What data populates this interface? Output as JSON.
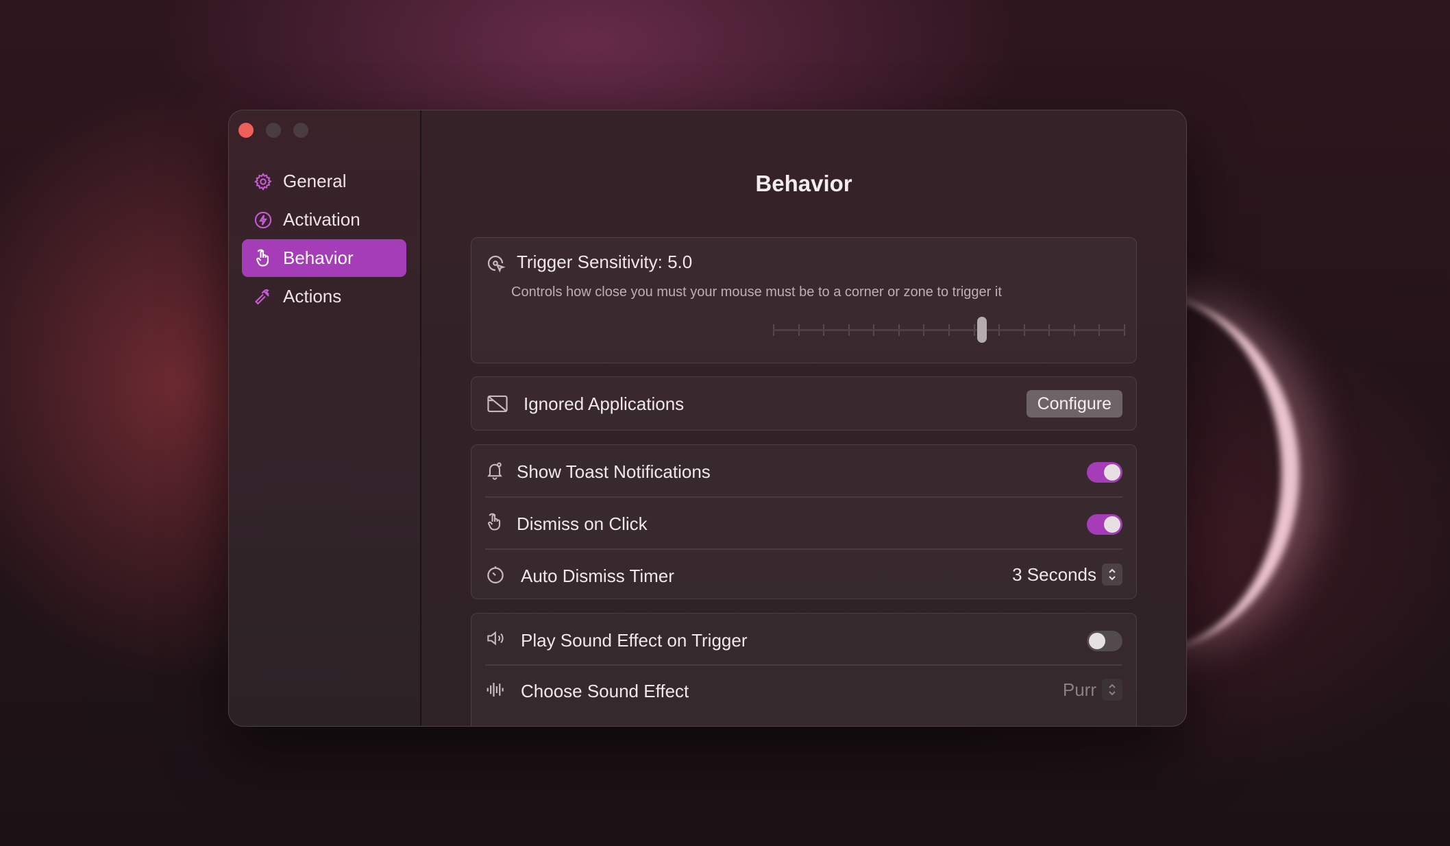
{
  "window": {
    "traffic_lights": [
      "close",
      "minimize",
      "zoom"
    ]
  },
  "sidebar": {
    "items": [
      {
        "label": "General",
        "icon": "gear-icon",
        "active": false
      },
      {
        "label": "Activation",
        "icon": "bolt-icon",
        "active": false
      },
      {
        "label": "Behavior",
        "icon": "hand-pointer-icon",
        "active": true
      },
      {
        "label": "Actions",
        "icon": "hammer-icon",
        "active": false
      }
    ]
  },
  "main": {
    "title": "Behavior",
    "sensitivity": {
      "label": "Trigger Sensitivity: 5.0",
      "description": "Controls how close you must your mouse must be to a corner or zone to trigger it",
      "icon": "cursor-target-icon",
      "value": 5.0,
      "min": 1,
      "max": 15,
      "ticks": 15
    },
    "ignored_apps": {
      "label": "Ignored Applications",
      "icon": "app-slash-icon",
      "button_label": "Configure"
    },
    "notifications": {
      "show_toast": {
        "label": "Show Toast Notifications",
        "icon": "bell-icon",
        "enabled": true
      },
      "dismiss_click": {
        "label": "Dismiss on Click",
        "icon": "hand-pointer-icon",
        "enabled": true
      },
      "auto_dismiss": {
        "label": "Auto Dismiss Timer",
        "icon": "timer-icon",
        "value": "3 Seconds"
      }
    },
    "sound": {
      "play": {
        "label": "Play Sound Effect on Trigger",
        "icon": "speaker-icon",
        "enabled": false
      },
      "choose": {
        "label": "Choose Sound Effect",
        "icon": "waveform-icon",
        "value": "Purr"
      }
    }
  },
  "colors": {
    "accent": "#a53db8",
    "close_button": "#ed5f57"
  }
}
